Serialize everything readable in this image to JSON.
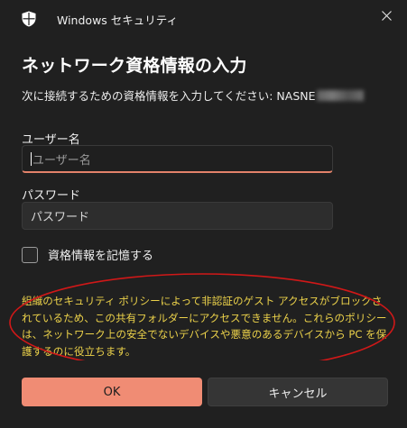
{
  "window": {
    "app_title": "Windows セキュリティ",
    "close_icon": "close-icon",
    "app_icon": "shield-icon"
  },
  "dialog": {
    "heading": "ネットワーク資格情報の入力",
    "prompt": "次に接続するための資格情報を入力してください: NASNE",
    "username_label": "ユーザー名",
    "username_placeholder": "ユーザー名",
    "username_value": "",
    "password_label": "パスワード",
    "password_placeholder": "パスワード",
    "password_value": "",
    "remember_label": "資格情報を記憶する",
    "remember_checked": false,
    "warning": "組織のセキュリティ ポリシーによって非認証のゲスト アクセスがブロックされているため、この共有フォルダーにアクセスできません。これらのポリシーは、ネットワーク上の安全でないデバイスや悪意のあるデバイスから PC を保護するのに役立ちます。",
    "ok_label": "OK",
    "cancel_label": "キャンセル"
  },
  "colors": {
    "background": "#202020",
    "accent": "#f08c74",
    "warning_text": "#ecd24a",
    "annotation_ellipse": "#d01818"
  }
}
